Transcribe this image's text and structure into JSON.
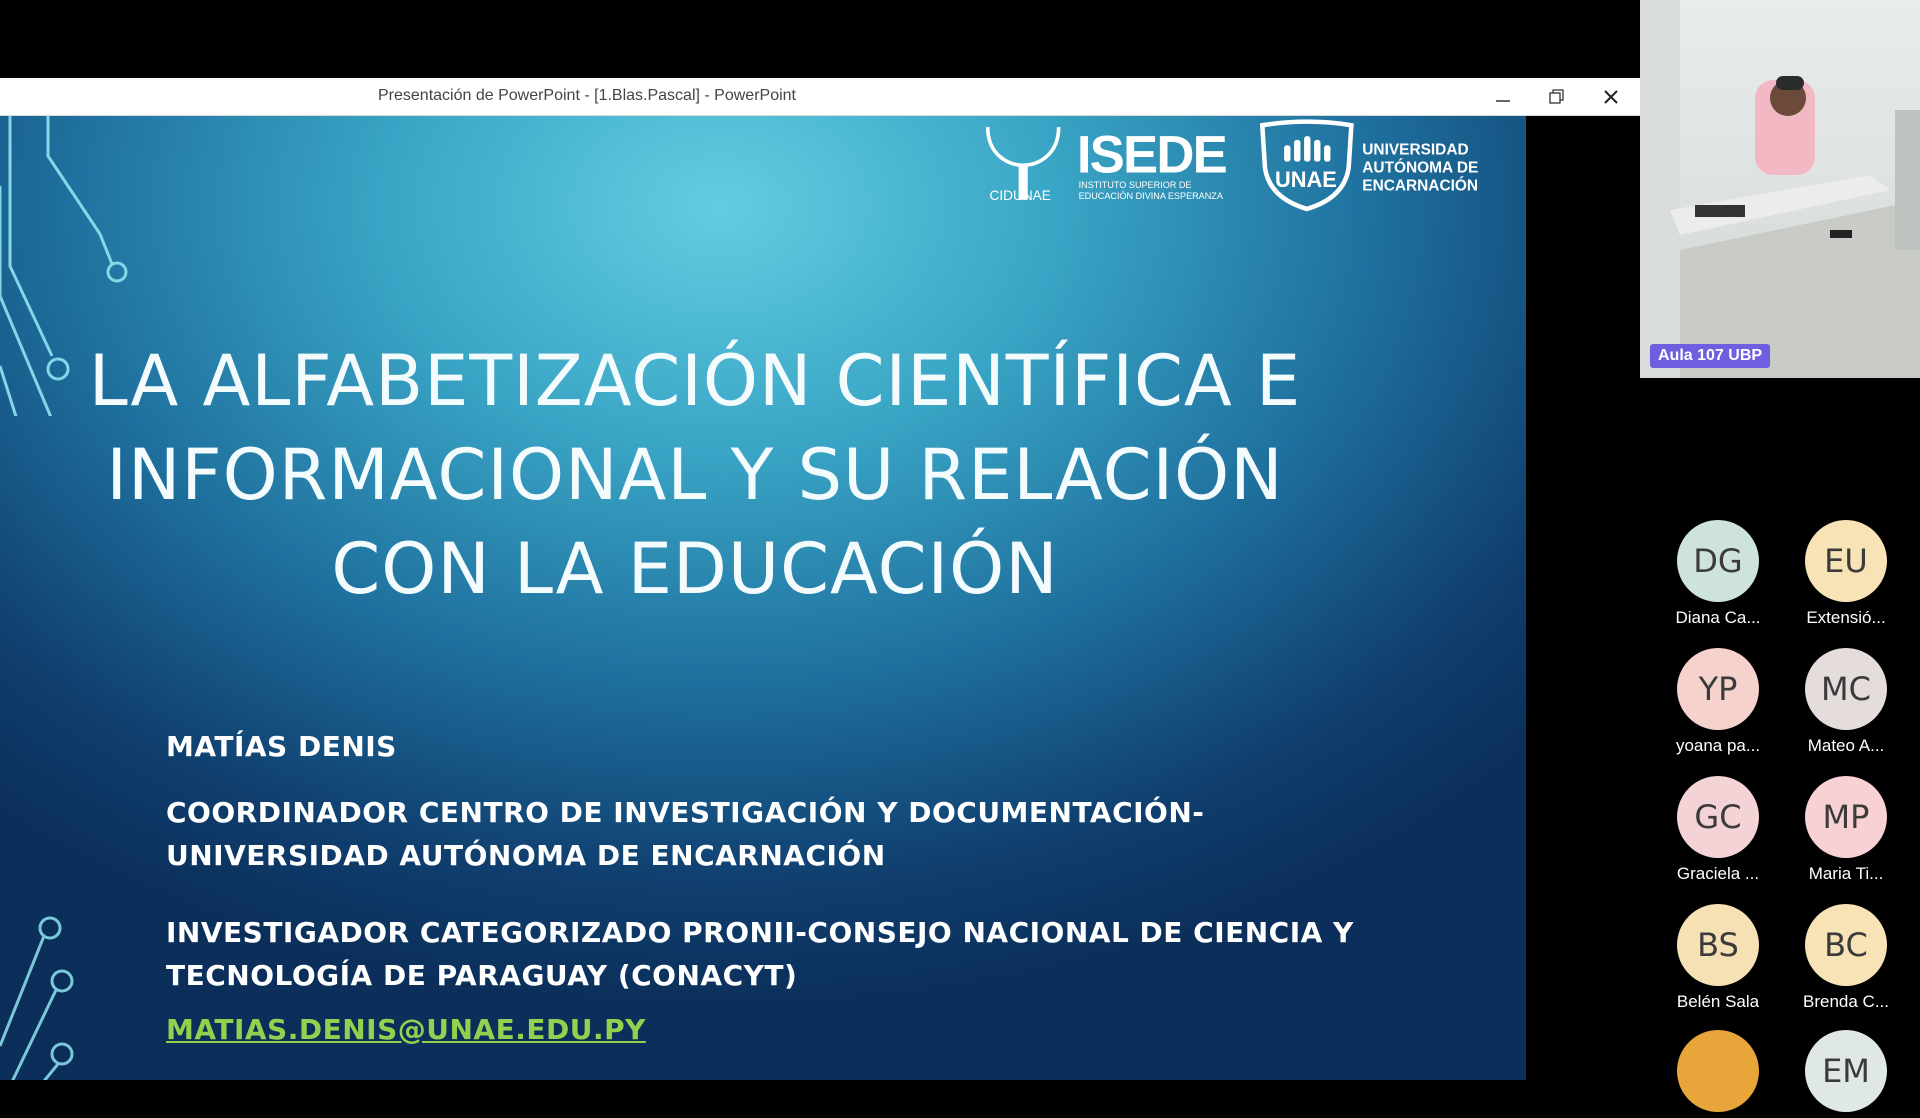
{
  "window": {
    "title": "Presentación de PowerPoint - [1.Blas.Pascal] - PowerPoint"
  },
  "slide": {
    "logos": {
      "cidunae": "CIDUNAE",
      "isede": "ISEDE",
      "isede_sub_1": "INSTITUTO SUPERIOR DE",
      "isede_sub_2": "EDUCACIÓN DIVINA ESPERANZA",
      "unae_badge": "UNAE",
      "unae_line_1": "UNIVERSIDAD",
      "unae_line_2": "AUTÓNOMA DE",
      "unae_line_3": "ENCARNACIÓN"
    },
    "title_lines": [
      "LA ALFABETIZACIÓN CIENTÍFICA E",
      "INFORMACIONAL Y SU RELACIÓN",
      "CON LA EDUCACIÓN"
    ],
    "presenter_name": "MATÍAS DENIS",
    "role_1_line_1": "COORDINADOR CENTRO DE INVESTIGACIÓN Y DOCUMENTACIÓN-",
    "role_1_line_2": "UNIVERSIDAD AUTÓNOMA DE ENCARNACIÓN",
    "role_2_line_1": "INVESTIGADOR CATEGORIZADO PRONII-CONSEJO NACIONAL DE CIENCIA Y",
    "role_2_line_2": "TECNOLOGÍA DE PARAGUAY (CONACYT)",
    "email": "MATIAS.DENIS@UNAE.EDU.PY",
    "email_color": "#92d050"
  },
  "meeting": {
    "video_label": "Aula 107 UBP",
    "participants": [
      {
        "initials": "DG",
        "name": "Diana Ca...",
        "color": "#cde3dc"
      },
      {
        "initials": "EU",
        "name": "Extensió...",
        "color": "#f7e3b6"
      },
      {
        "initials": "YP",
        "name": "yoana pa...",
        "color": "#f6d2cc"
      },
      {
        "initials": "MC",
        "name": "Mateo A...",
        "color": "#e5dcdc"
      },
      {
        "initials": "GC",
        "name": "Graciela ...",
        "color": "#f3d3d6"
      },
      {
        "initials": "MP",
        "name": "Maria Ti...",
        "color": "#f7d1d3"
      },
      {
        "initials": "BS",
        "name": "Belén Sala",
        "color": "#f6e1b4"
      },
      {
        "initials": "BC",
        "name": "Brenda C...",
        "color": "#f7e3b6"
      },
      {
        "initials": "",
        "name": "",
        "color": "#e8a53a"
      },
      {
        "initials": "EM",
        "name": "",
        "color": "#dfe8e4"
      }
    ]
  }
}
